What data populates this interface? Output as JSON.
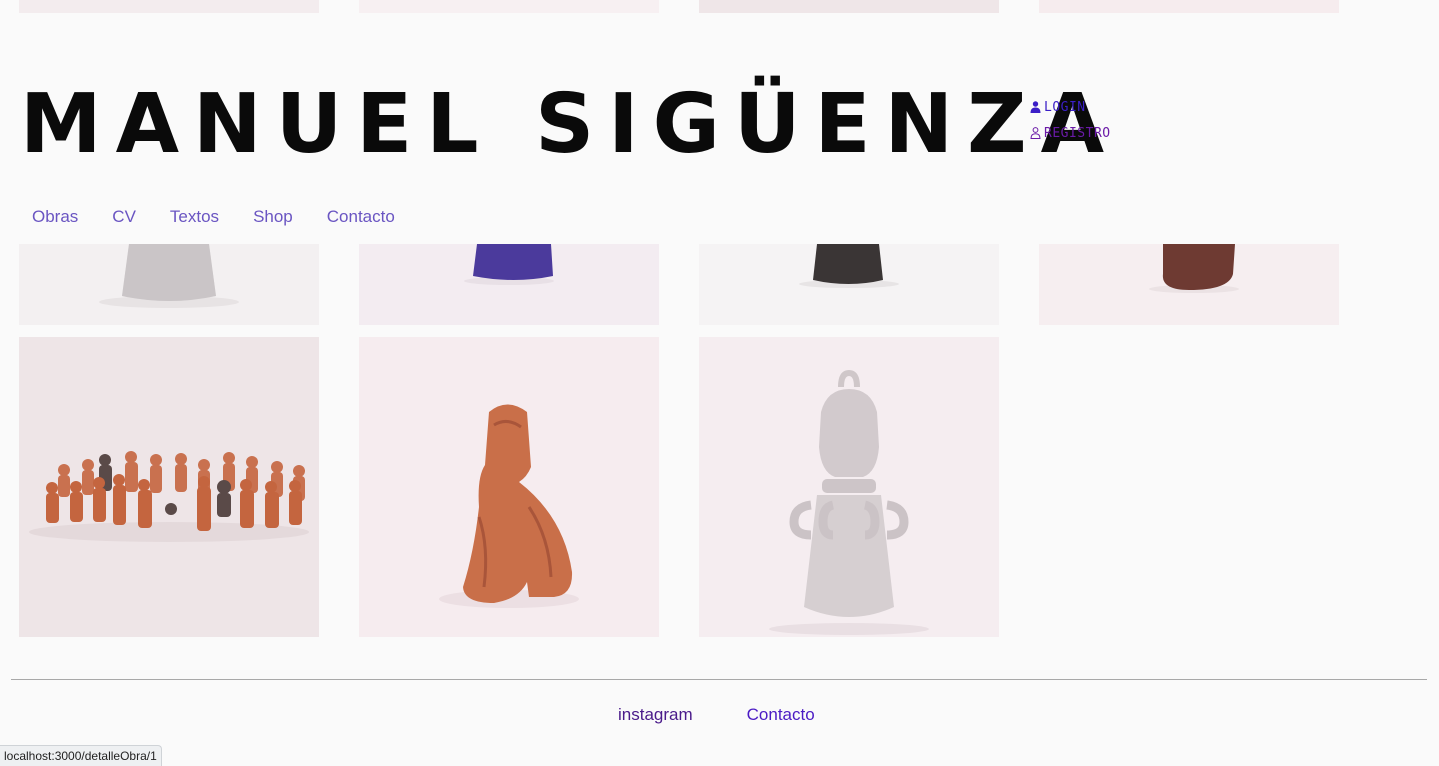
{
  "site": {
    "title": "MANUEL SIGÜENZA"
  },
  "auth": {
    "login_label": "LOGIN",
    "registro_label": "REGISTRO"
  },
  "nav": {
    "items": [
      "Obras",
      "CV",
      "Textos",
      "Shop",
      "Contacto"
    ]
  },
  "footer": {
    "instagram_label": "instagram",
    "contacto_label": "Contacto"
  },
  "status": {
    "url": "localhost:3000/detalleObra/1"
  },
  "colors": {
    "nav_link": "#6a55c2",
    "login": "#3b1fc7",
    "registro": "#6a1aa7",
    "title": "#0a0a0a",
    "background": "#fafafa"
  },
  "icons": {
    "login": "user-solid-icon",
    "registro": "user-outline-icon"
  }
}
